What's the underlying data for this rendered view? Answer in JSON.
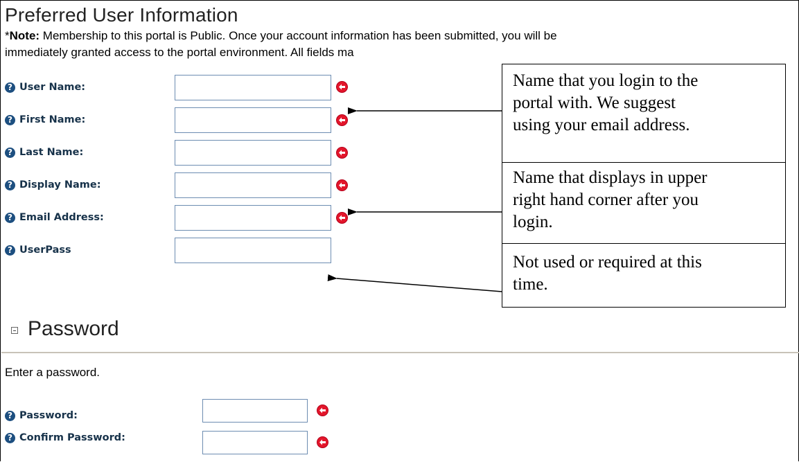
{
  "header": {
    "title": "Preferred User Information",
    "note_label": "Note:",
    "note_prefix": "*",
    "note_line1": " Membership to this portal is Public. Once your account information has been submitted, you will be",
    "note_line2": "immediately granted access to the portal environment. All fields ma"
  },
  "fields": [
    {
      "label": "User Name:",
      "value": "",
      "required": true
    },
    {
      "label": "First Name:",
      "value": "",
      "required": true
    },
    {
      "label": "Last Name:",
      "value": "",
      "required": true
    },
    {
      "label": "Display Name:",
      "value": "",
      "required": true
    },
    {
      "label": "Email Address:",
      "value": "",
      "required": true
    },
    {
      "label": "UserPass",
      "value": "",
      "required": false
    }
  ],
  "callouts": [
    {
      "line1": "Name that you login to the",
      "line2": "portal with. We suggest",
      "line3": "using your email address."
    },
    {
      "line1": "Name that displays in upper",
      "line2": "right hand corner after you",
      "line3": "login."
    },
    {
      "line1": "Not used or required at this",
      "line2": "time."
    }
  ],
  "password_section": {
    "title": "Password",
    "instruction": "Enter a password.",
    "fields": [
      {
        "label": "Password:",
        "value": "",
        "required": true
      },
      {
        "label": "Confirm Password:",
        "value": "",
        "required": true
      }
    ]
  },
  "icons": {
    "help": "help-icon",
    "required": "required-arrow-icon",
    "collapse": "collapse-icon"
  },
  "colors": {
    "label_text": "#17324a",
    "help_icon": "#1d4f80",
    "required_icon": "#e3162b",
    "input_border": "#6c8cb1",
    "divider": "#c8c2b8"
  }
}
